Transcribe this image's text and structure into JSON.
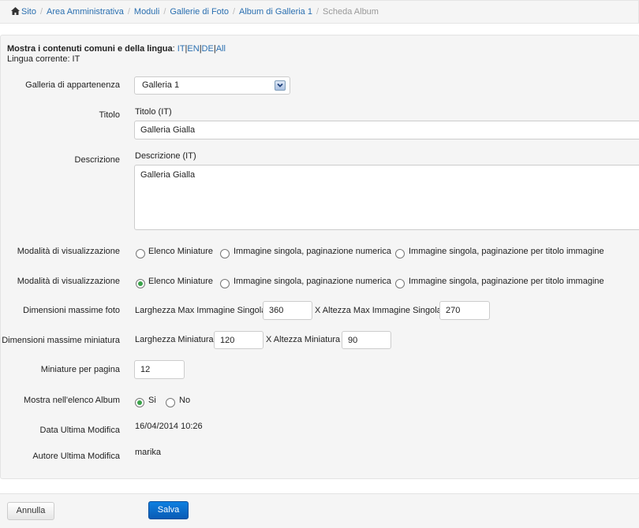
{
  "breadcrumb": {
    "items": [
      "Sito",
      "Area Amministrativa",
      "Moduli",
      "Gallerie di Foto",
      "Album di Galleria 1"
    ],
    "current": "Scheda Album",
    "separator": "/"
  },
  "lang": {
    "heading": "Mostra i contenuti comuni e della lingua",
    "colon": ":",
    "links": [
      "IT",
      "EN",
      "DE",
      "All"
    ],
    "current_label": "Lingua corrente: IT"
  },
  "form": {
    "gallery": {
      "label": "Galleria di appartenenza",
      "value": "Galleria 1"
    },
    "title": {
      "label": "Titolo",
      "sublabel": "Titolo (IT)",
      "value": "Galleria Gialla"
    },
    "description": {
      "label": "Descrizione",
      "sublabel": "Descrizione (IT)",
      "value": "Galleria Gialla"
    },
    "display_mode_1": {
      "label": "Modalità di visualizzazione",
      "options": [
        "Elenco Miniature",
        "Immagine singola, paginazione numerica",
        "Immagine singola, paginazione per titolo immagine"
      ],
      "selected": -1
    },
    "display_mode_2": {
      "label": "Modalità di visualizzazione",
      "options": [
        "Elenco Miniature",
        "Immagine singola, paginazione numerica",
        "Immagine singola, paginazione per titolo immagine"
      ],
      "selected": 0
    },
    "photo_size": {
      "label": "Dimensioni massime foto",
      "width_label": "Larghezza Max Immagine Singola",
      "width_value": "360",
      "height_label": "X Altezza Max Immagine Singola",
      "height_value": "270"
    },
    "thumb_size": {
      "label": "Dimensioni massime miniatura",
      "width_label": "Larghezza Miniatura",
      "width_value": "120",
      "height_label": "X Altezza Miniatura",
      "height_value": "90"
    },
    "per_page": {
      "label": "Miniature per pagina",
      "value": "12"
    },
    "show_in_list": {
      "label": "Mostra nell'elenco Album",
      "options": [
        "Si",
        "No"
      ],
      "selected": 0
    },
    "last_modified": {
      "label": "Data Ultima Modifica",
      "value": "16/04/2014 10:26"
    },
    "last_author": {
      "label": "Autore Ultima Modifica",
      "value": "marika"
    }
  },
  "buttons": {
    "cancel": "Annulla",
    "save": "Salva"
  },
  "colors": {
    "link": "#2a6fb0",
    "save_button": "#0a5bb5",
    "radio_selected": "#3aa34a"
  },
  "icons": {
    "home": "home-icon",
    "dropdown": "chevron-down-icon"
  }
}
